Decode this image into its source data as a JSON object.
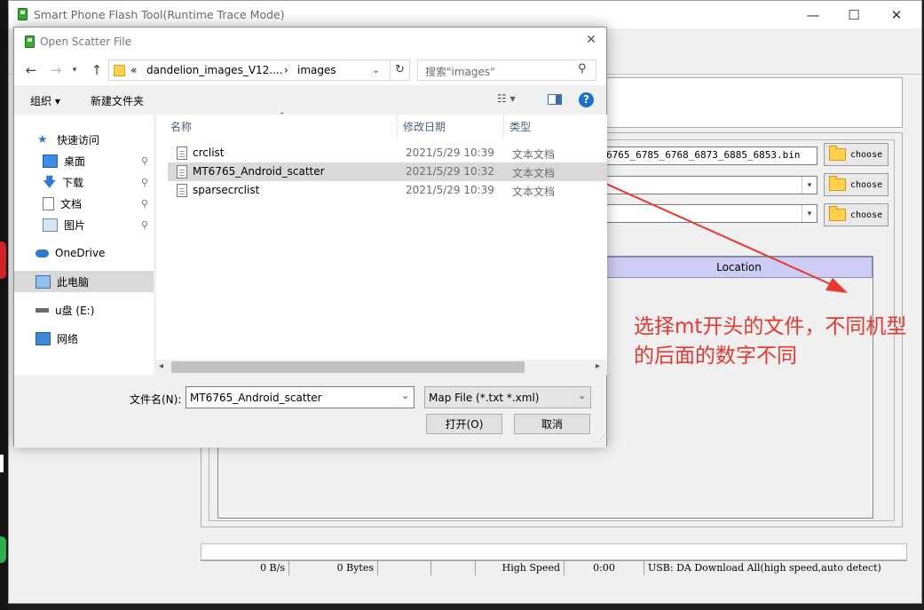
{
  "main_window": {
    "title": "Smart Phone Flash Tool(Runtime Trace Mode)",
    "minimize": "—",
    "maximize": "☐",
    "close": "✕",
    "download_agent_path": "6765_6785_6768_6873_6885_6853.bin",
    "choose_label": "choose",
    "table_header_location": "Location",
    "status": {
      "speed": "0 B/s",
      "bytes": "0 Bytes",
      "usb_speed": "High Speed",
      "time": "0:00",
      "mode": "USB: DA Download All(high speed,auto detect)"
    }
  },
  "annotation": {
    "text": "选择mt开头的文件，不同机型的后面的数字不同",
    "color": "#e8372f"
  },
  "dialog": {
    "title": "Open Scatter File",
    "close": "✕",
    "address": {
      "overflow": "«",
      "segment1": "dandelion_images_V12....",
      "separator": "›",
      "segment2": "images"
    },
    "search_placeholder": "搜索\"images\"",
    "toolbar": {
      "organize": "组织 ▾",
      "new_folder": "新建文件夹"
    },
    "nav_items": [
      {
        "label": "快速访问",
        "icon": "star-icon"
      },
      {
        "label": "桌面",
        "icon": "desktop-icon"
      },
      {
        "label": "下载",
        "icon": "download-icon"
      },
      {
        "label": "文档",
        "icon": "document-icon"
      },
      {
        "label": "图片",
        "icon": "picture-icon"
      },
      {
        "label": "OneDrive",
        "icon": "cloud-icon"
      },
      {
        "label": "此电脑",
        "icon": "computer-icon"
      },
      {
        "label": "u盘 (E:)",
        "icon": "drive-icon"
      },
      {
        "label": "网络",
        "icon": "network-icon"
      }
    ],
    "columns": {
      "name": "名称",
      "date": "修改日期",
      "type": "类型"
    },
    "files": [
      {
        "name": "crclist",
        "date": "2021/5/29 10:39",
        "type": "文本文档"
      },
      {
        "name": "MT6765_Android_scatter",
        "date": "2021/5/29 10:32",
        "type": "文本文档"
      },
      {
        "name": "sparsecrclist",
        "date": "2021/5/29 10:39",
        "type": "文本文档"
      }
    ],
    "filename_label": "文件名(N):",
    "filename_value": "MT6765_Android_scatter",
    "filter_value": "Map File (*.txt *.xml)",
    "open_button": "打开(O)",
    "cancel_button": "取消"
  },
  "colors": {
    "selection": "#d9d9d9",
    "annotation_red": "#e8372f",
    "location_header": "#ccccf4"
  }
}
